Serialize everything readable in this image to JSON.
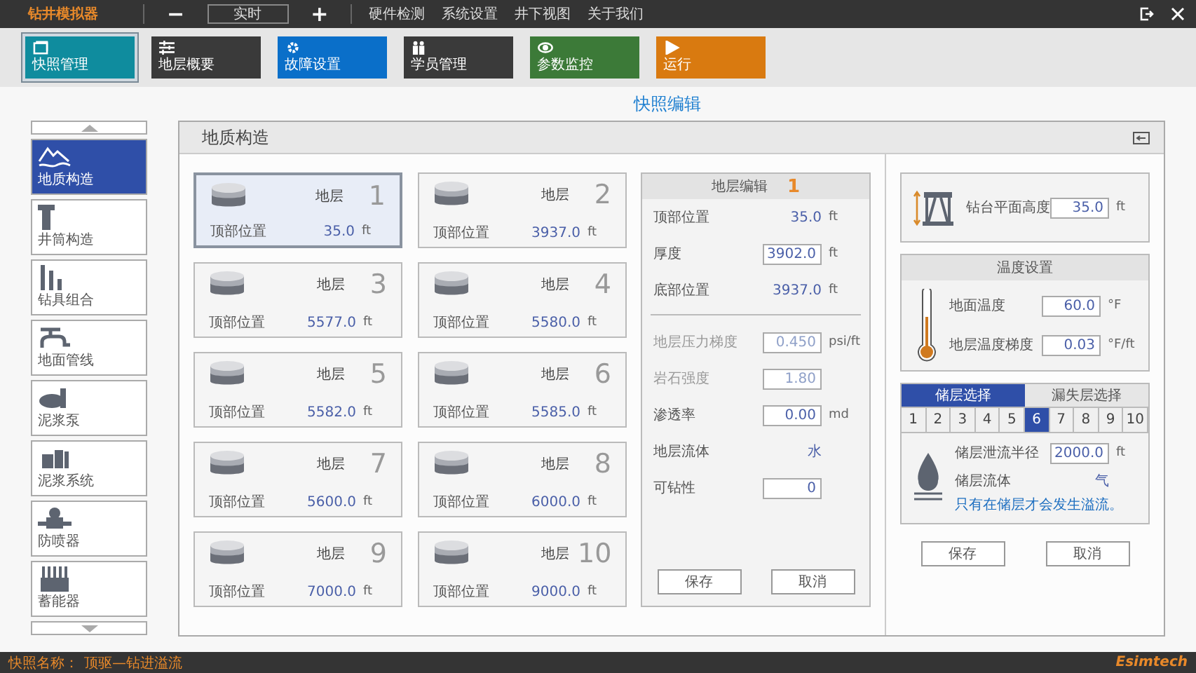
{
  "app": {
    "title": "钻井模拟器",
    "minus": "−",
    "mode": "实时",
    "plus": "+",
    "menu": [
      "硬件检测",
      "系统设置",
      "井下视图",
      "关于我们"
    ]
  },
  "modules": [
    {
      "label": "快照管理",
      "color": "#0f8c9e",
      "kind": "snapshot",
      "selected": true
    },
    {
      "label": "地层概要",
      "color": "#3a3a3a",
      "kind": "sliders",
      "selected": false
    },
    {
      "label": "故障设置",
      "color": "#0a6fc9",
      "kind": "gear",
      "selected": false
    },
    {
      "label": "学员管理",
      "color": "#3a3a3a",
      "kind": "people",
      "selected": false
    },
    {
      "label": "参数监控",
      "color": "#3c7a38",
      "kind": "eye",
      "selected": false
    },
    {
      "label": "运行",
      "color": "#d97a10",
      "kind": "play",
      "selected": false
    }
  ],
  "page_title": "快照编辑",
  "sidebar": [
    {
      "label": "地质构造",
      "kind": "mountain",
      "selected": true
    },
    {
      "label": "井筒构造",
      "kind": "casing",
      "selected": false
    },
    {
      "label": "钻具组合",
      "kind": "tools",
      "selected": false
    },
    {
      "label": "地面管线",
      "kind": "pipe",
      "selected": false
    },
    {
      "label": "泥浆泵",
      "kind": "pump",
      "selected": false
    },
    {
      "label": "泥浆系统",
      "kind": "tanks",
      "selected": false
    },
    {
      "label": "防喷器",
      "kind": "bop",
      "selected": false
    },
    {
      "label": "蓄能器",
      "kind": "accumulator",
      "selected": false
    }
  ],
  "panel": {
    "title": "地质构造"
  },
  "layers": [
    {
      "label": "地层",
      "number": "1",
      "position_label": "顶部位置",
      "value": "35.0",
      "unit": "ft",
      "selected": true
    },
    {
      "label": "地层",
      "number": "2",
      "position_label": "顶部位置",
      "value": "3937.0",
      "unit": "ft",
      "selected": false
    },
    {
      "label": "地层",
      "number": "3",
      "position_label": "顶部位置",
      "value": "5577.0",
      "unit": "ft",
      "selected": false
    },
    {
      "label": "地层",
      "number": "4",
      "position_label": "顶部位置",
      "value": "5580.0",
      "unit": "ft",
      "selected": false
    },
    {
      "label": "地层",
      "number": "5",
      "position_label": "顶部位置",
      "value": "5582.0",
      "unit": "ft",
      "selected": false
    },
    {
      "label": "地层",
      "number": "6",
      "position_label": "顶部位置",
      "value": "5585.0",
      "unit": "ft",
      "selected": false
    },
    {
      "label": "地层",
      "number": "7",
      "position_label": "顶部位置",
      "value": "5600.0",
      "unit": "ft",
      "selected": false
    },
    {
      "label": "地层",
      "number": "8",
      "position_label": "顶部位置",
      "value": "6000.0",
      "unit": "ft",
      "selected": false
    },
    {
      "label": "地层",
      "number": "9",
      "position_label": "顶部位置",
      "value": "7000.0",
      "unit": "ft",
      "selected": false
    },
    {
      "label": "地层",
      "number": "10",
      "position_label": "顶部位置",
      "value": "9000.0",
      "unit": "ft",
      "selected": false
    }
  ],
  "layer_edit": {
    "title": "地层编辑",
    "number": "1",
    "rows_top": [
      {
        "label": "顶部位置",
        "value": "35.0",
        "unit": "ft",
        "kind": "text",
        "disabled": false
      },
      {
        "label": "厚度",
        "value": "3902.0",
        "unit": "ft",
        "kind": "input",
        "disabled": false
      },
      {
        "label": "底部位置",
        "value": "3937.0",
        "unit": "ft",
        "kind": "text",
        "disabled": false
      }
    ],
    "rows_bottom": [
      {
        "label": "地层压力梯度",
        "value": "0.450",
        "unit": "psi/ft",
        "kind": "input",
        "disabled": true
      },
      {
        "label": "岩石强度",
        "value": "1.80",
        "kind": "input",
        "disabled": true
      },
      {
        "label": "渗透率",
        "value": "0.00",
        "unit": "md",
        "kind": "input",
        "disabled": false
      },
      {
        "label": "地层流体",
        "value": "水",
        "kind": "text",
        "disabled": false
      },
      {
        "label": "可钻性",
        "value": "0",
        "kind": "input",
        "disabled": false
      }
    ],
    "buttons": [
      "保存",
      "取消"
    ]
  },
  "rig": {
    "label": "钻台平面高度",
    "value": "35.0",
    "unit": "ft"
  },
  "temperature": {
    "title": "温度设置",
    "rows": [
      {
        "label": "地面温度",
        "value": "60.0",
        "unit": "°F"
      },
      {
        "label": "地层温度梯度",
        "value": "0.03",
        "unit": "°F/ft"
      }
    ]
  },
  "reservoir": {
    "tabs": [
      {
        "label": "储层选择",
        "selected": true
      },
      {
        "label": "漏失层选择",
        "selected": false
      }
    ],
    "numbers": [
      {
        "label": "1",
        "selected": false
      },
      {
        "label": "2",
        "selected": false
      },
      {
        "label": "3",
        "selected": false
      },
      {
        "label": "4",
        "selected": false
      },
      {
        "label": "5",
        "selected": false
      },
      {
        "label": "6",
        "selected": true
      },
      {
        "label": "7",
        "selected": false
      },
      {
        "label": "8",
        "selected": false
      },
      {
        "label": "9",
        "selected": false
      },
      {
        "label": "10",
        "selected": false
      }
    ],
    "rows": [
      {
        "label": "储层泄流半径",
        "value": "2000.0",
        "unit": "ft",
        "kind": "input"
      },
      {
        "label": "储层流体",
        "value": "气",
        "kind": "text"
      }
    ],
    "note": "只有在储层才会发生溢流。"
  },
  "right_buttons": [
    "保存",
    "取消"
  ],
  "footer": {
    "snapshot_label": "快照名称：",
    "snapshot_name": "顶驱—钻进溢流",
    "brand": "Esimtech"
  }
}
